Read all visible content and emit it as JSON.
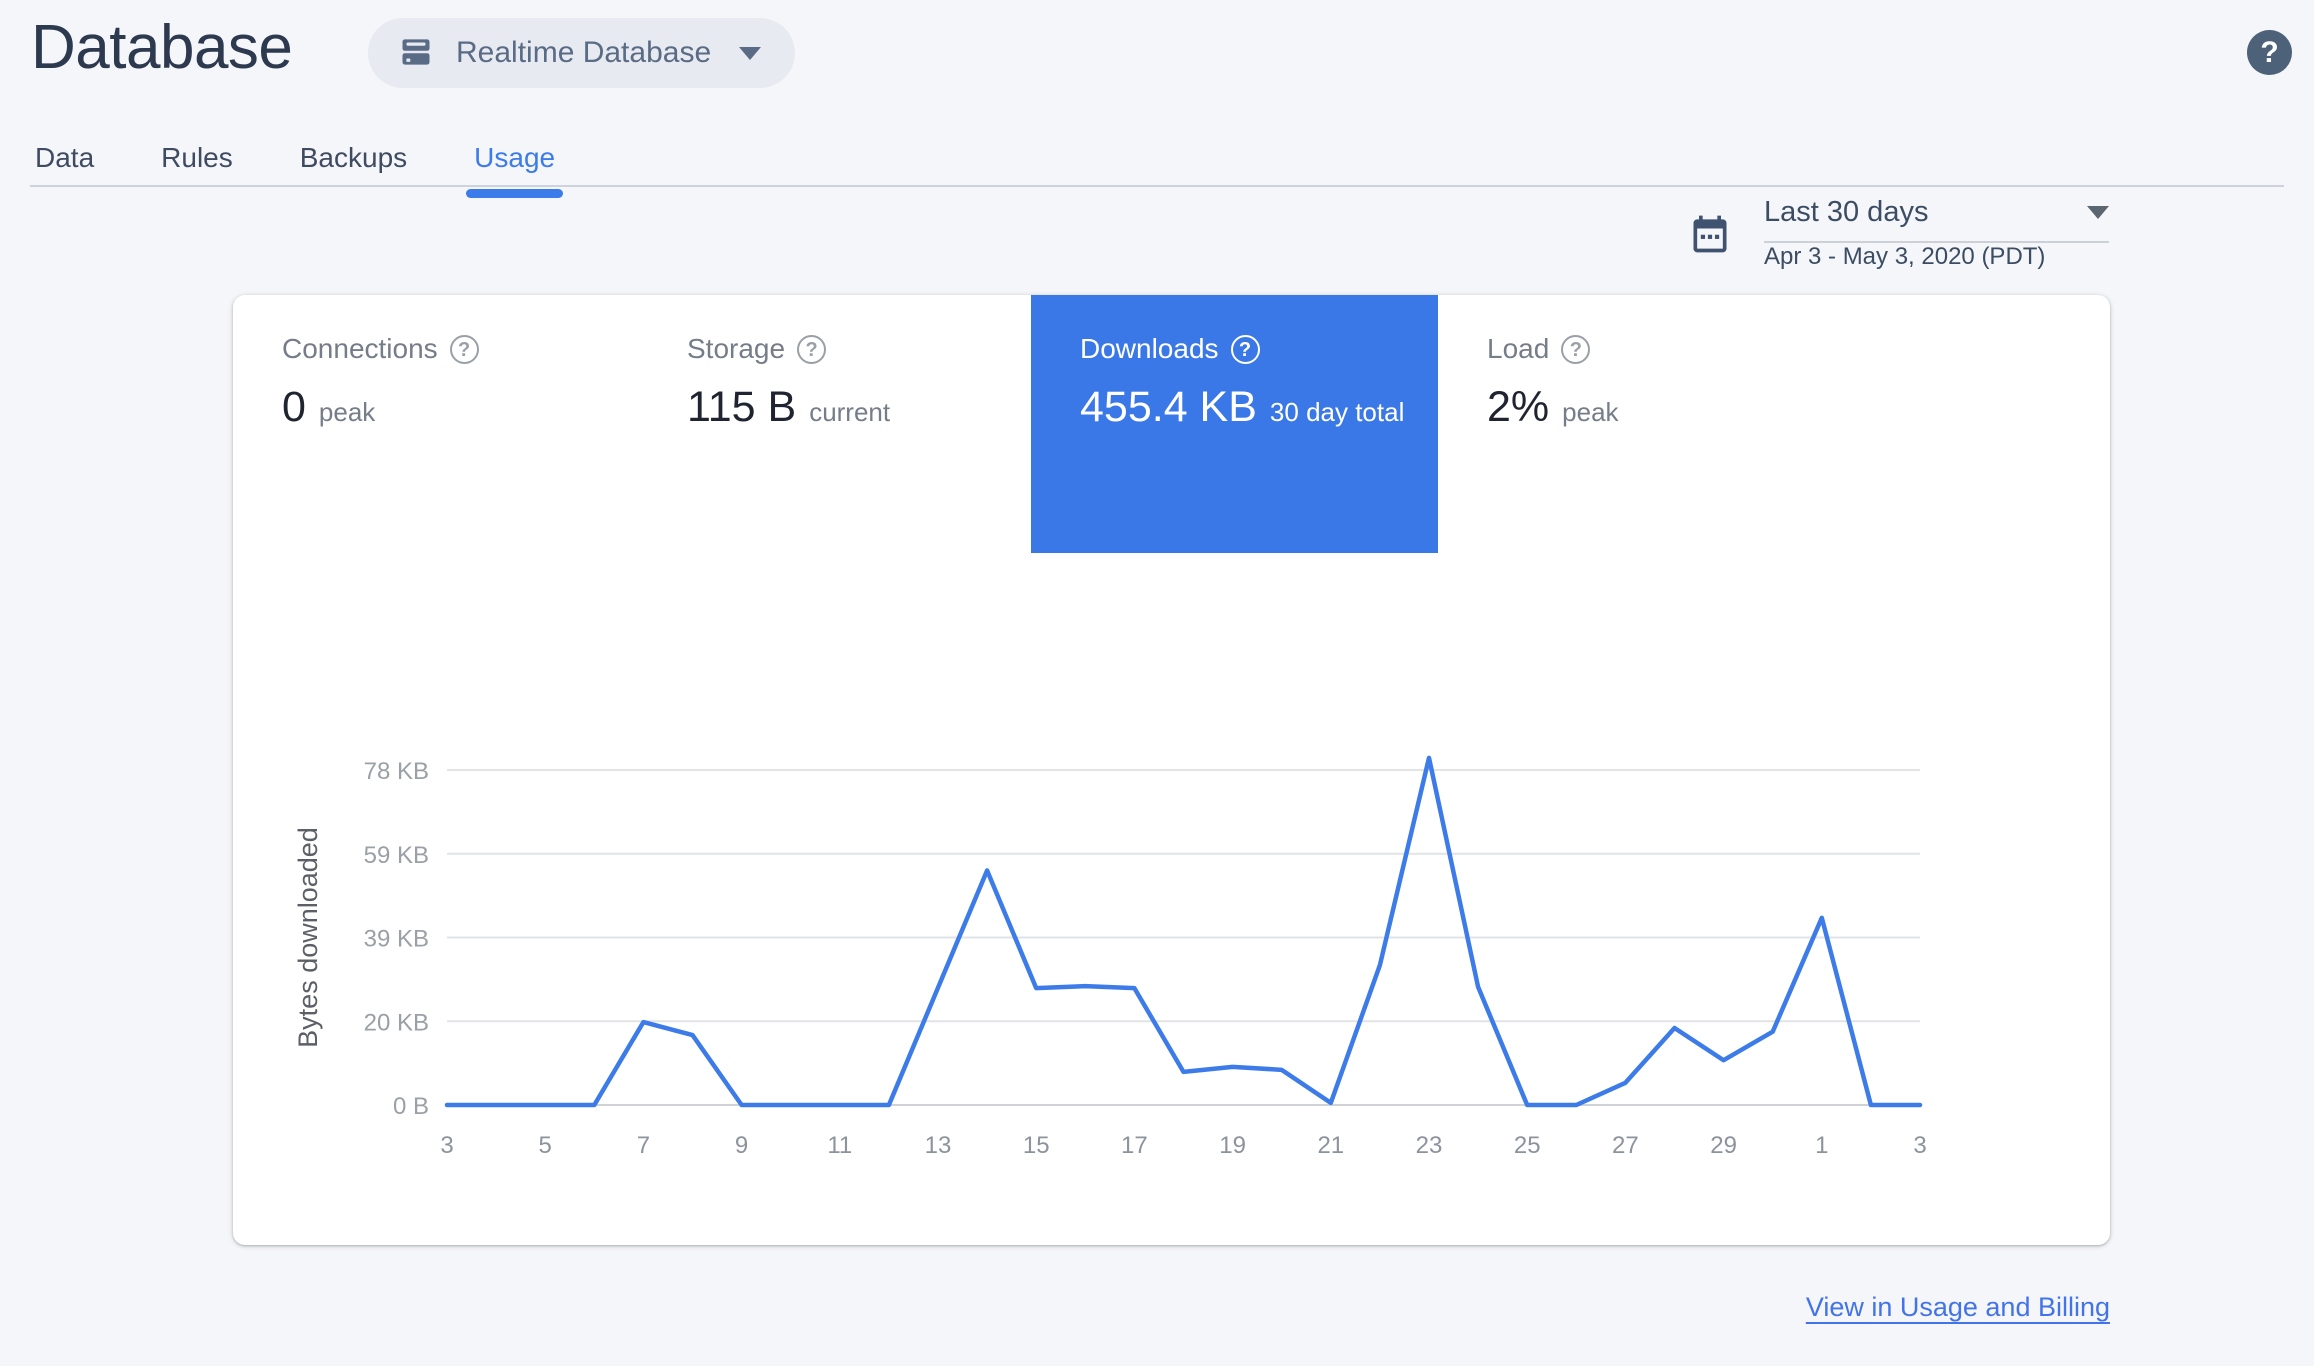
{
  "header": {
    "title": "Database",
    "database_selector": {
      "label": "Realtime Database"
    },
    "help_label": "?"
  },
  "tabs": [
    {
      "label": "Data",
      "active": false
    },
    {
      "label": "Rules",
      "active": false
    },
    {
      "label": "Backups",
      "active": false
    },
    {
      "label": "Usage",
      "active": true
    }
  ],
  "date_range": {
    "label": "Last 30 days",
    "detail": "Apr 3 - May 3, 2020 (PDT)"
  },
  "stats": [
    {
      "label": "Connections",
      "value": "0",
      "suffix": "peak",
      "selected": false
    },
    {
      "label": "Storage",
      "value": "115 B",
      "suffix": "current",
      "selected": false
    },
    {
      "label": "Downloads",
      "value": "455.4 KB",
      "suffix": "30 day total",
      "selected": true
    },
    {
      "label": "Load",
      "value": "2%",
      "suffix": "peak",
      "selected": false
    }
  ],
  "help_glyph": "?",
  "chart_data": {
    "type": "line",
    "title": "Downloads — bytes downloaded per day, Apr 3 - May 3, 2020",
    "ylabel": "Bytes downloaded",
    "x_days": [
      3,
      4,
      5,
      6,
      7,
      8,
      9,
      10,
      11,
      12,
      13,
      14,
      15,
      16,
      17,
      18,
      19,
      20,
      21,
      22,
      23,
      24,
      25,
      26,
      27,
      28,
      29,
      30,
      1,
      2,
      3
    ],
    "x_tick_labels": [
      "3",
      "5",
      "7",
      "9",
      "11",
      "13",
      "15",
      "17",
      "19",
      "21",
      "23",
      "25",
      "27",
      "29",
      "1",
      "3"
    ],
    "y_tick_labels": [
      "0 B",
      "20 KB",
      "39 KB",
      "59 KB",
      "78 KB"
    ],
    "y_tick_bytes": [
      0,
      20000,
      40000,
      60000,
      80000
    ],
    "ylim_bytes": [
      0,
      82900
    ],
    "grid": true,
    "legend": "none",
    "series": [
      {
        "name": "Bytes downloaded",
        "values_bytes": [
          0,
          0,
          0,
          0,
          19800,
          16700,
          0,
          0,
          0,
          0,
          28000,
          56000,
          27900,
          28400,
          27900,
          7900,
          9100,
          8400,
          500,
          33400,
          82900,
          28200,
          0,
          0,
          5300,
          18400,
          10700,
          17500,
          44700,
          0,
          0
        ]
      }
    ]
  },
  "footer": {
    "link_label": "View in Usage and Billing"
  },
  "colors": {
    "accent_blue": "#3B78E7",
    "chart_line": "#3D7CE8",
    "active_tab_blue": "#3C7BEA",
    "link_blue": "#4273E8",
    "slate": "#5A6B85",
    "title_navy": "#2C394E",
    "axis_gray": "#9aa0a6"
  }
}
